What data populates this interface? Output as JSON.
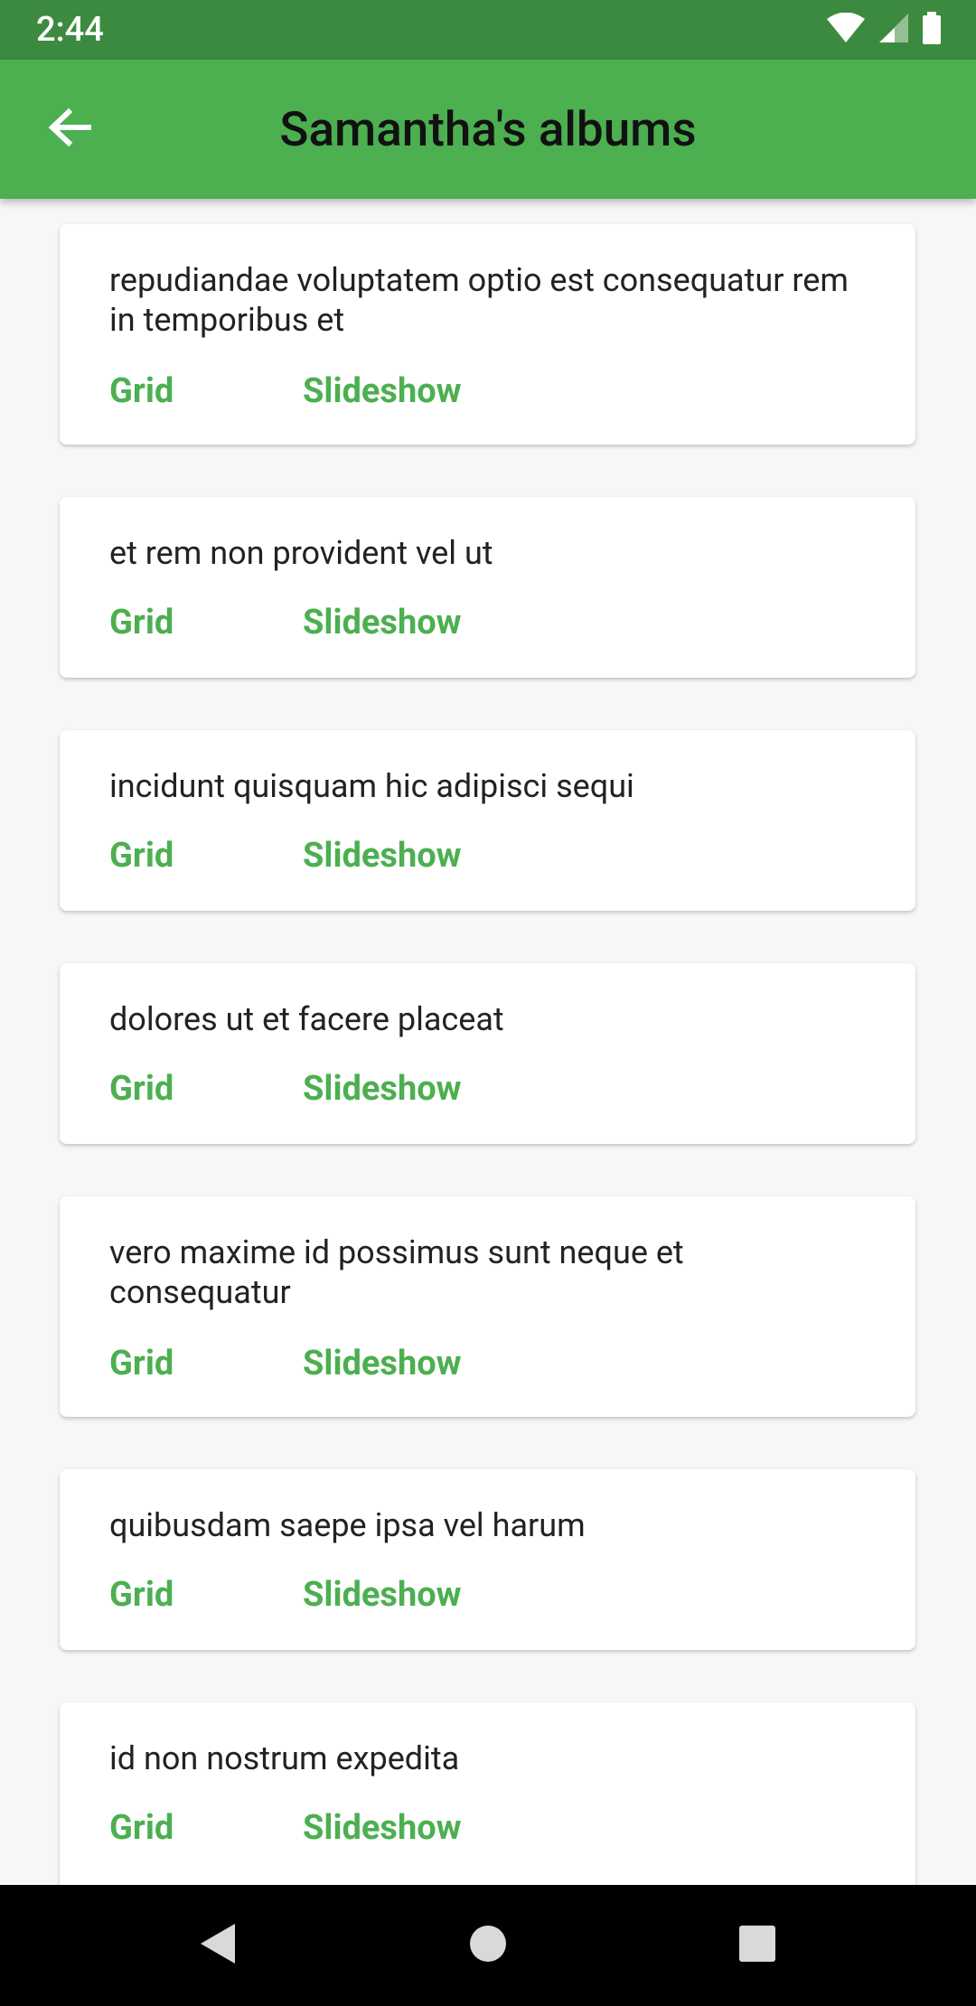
{
  "status_bar": {
    "time": "2:44",
    "icons": [
      "wifi-icon",
      "signal-icon",
      "battery-icon"
    ]
  },
  "app_bar": {
    "title": "Samantha's albums",
    "back_icon": "arrow-back-icon"
  },
  "colors": {
    "status_bar": "#3c8a3f",
    "app_bar": "#4caf50",
    "accent": "#4caf50",
    "background": "#f7f7f7"
  },
  "albums": [
    {
      "title": "repudiandae voluptatem optio est consequatur rem in temporibus et",
      "grid_label": "Grid",
      "slideshow_label": "Slideshow"
    },
    {
      "title": "et rem non provident vel ut",
      "grid_label": "Grid",
      "slideshow_label": "Slideshow"
    },
    {
      "title": "incidunt quisquam hic adipisci sequi",
      "grid_label": "Grid",
      "slideshow_label": "Slideshow"
    },
    {
      "title": "dolores ut et facere placeat",
      "grid_label": "Grid",
      "slideshow_label": "Slideshow"
    },
    {
      "title": "vero maxime id possimus sunt neque et consequatur",
      "grid_label": "Grid",
      "slideshow_label": "Slideshow"
    },
    {
      "title": "quibusdam saepe ipsa vel harum",
      "grid_label": "Grid",
      "slideshow_label": "Slideshow"
    },
    {
      "title": "id non nostrum expedita",
      "grid_label": "Grid",
      "slideshow_label": "Slideshow"
    }
  ],
  "nav_bar": {
    "buttons": [
      "back-triangle-icon",
      "home-circle-icon",
      "recents-square-icon"
    ]
  }
}
